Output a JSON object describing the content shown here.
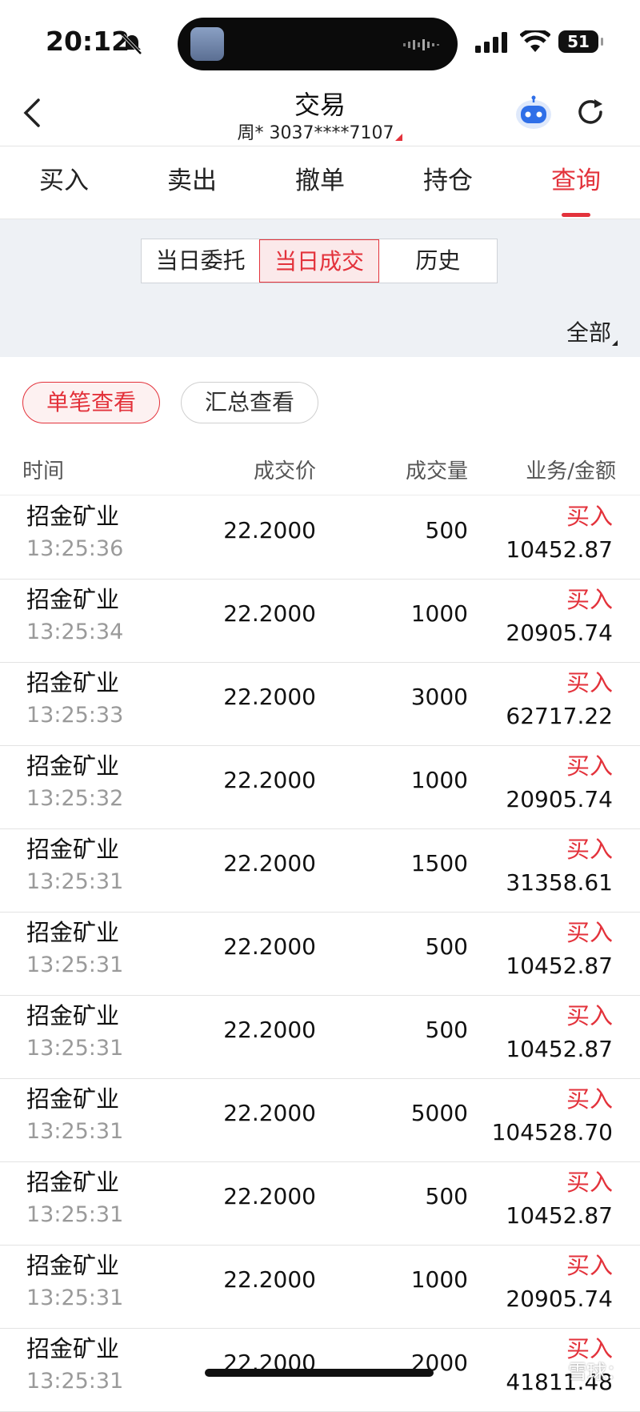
{
  "status_bar": {
    "time": "20:12",
    "battery": "51"
  },
  "header": {
    "title": "交易",
    "account": "周* 3037****7107"
  },
  "tabs": [
    {
      "label": "买入"
    },
    {
      "label": "卖出"
    },
    {
      "label": "撤单"
    },
    {
      "label": "持仓"
    },
    {
      "label": "查询",
      "active": true
    }
  ],
  "segments": [
    {
      "label": "当日委托"
    },
    {
      "label": "当日成交",
      "active": true
    },
    {
      "label": "历史"
    }
  ],
  "filter_label": "全部",
  "view_pills": [
    {
      "label": "单笔查看",
      "active": true
    },
    {
      "label": "汇总查看"
    }
  ],
  "columns": {
    "time": "时间",
    "price": "成交价",
    "qty": "成交量",
    "biz": "业务/金额"
  },
  "rows": [
    {
      "name": "招金矿业",
      "time": "13:25:36",
      "price": "22.2000",
      "qty": "500",
      "biz": "买入",
      "amount": "10452.87"
    },
    {
      "name": "招金矿业",
      "time": "13:25:34",
      "price": "22.2000",
      "qty": "1000",
      "biz": "买入",
      "amount": "20905.74"
    },
    {
      "name": "招金矿业",
      "time": "13:25:33",
      "price": "22.2000",
      "qty": "3000",
      "biz": "买入",
      "amount": "62717.22"
    },
    {
      "name": "招金矿业",
      "time": "13:25:32",
      "price": "22.2000",
      "qty": "1000",
      "biz": "买入",
      "amount": "20905.74"
    },
    {
      "name": "招金矿业",
      "time": "13:25:31",
      "price": "22.2000",
      "qty": "1500",
      "biz": "买入",
      "amount": "31358.61"
    },
    {
      "name": "招金矿业",
      "time": "13:25:31",
      "price": "22.2000",
      "qty": "500",
      "biz": "买入",
      "amount": "10452.87"
    },
    {
      "name": "招金矿业",
      "time": "13:25:31",
      "price": "22.2000",
      "qty": "500",
      "biz": "买入",
      "amount": "10452.87"
    },
    {
      "name": "招金矿业",
      "time": "13:25:31",
      "price": "22.2000",
      "qty": "5000",
      "biz": "买入",
      "amount": "104528.70"
    },
    {
      "name": "招金矿业",
      "time": "13:25:31",
      "price": "22.2000",
      "qty": "500",
      "biz": "买入",
      "amount": "10452.87"
    },
    {
      "name": "招金矿业",
      "time": "13:25:31",
      "price": "22.2000",
      "qty": "1000",
      "biz": "买入",
      "amount": "20905.74"
    },
    {
      "name": "招金矿业",
      "time": "13:25:31",
      "price": "22.2000",
      "qty": "2000",
      "biz": "买入",
      "amount": "41811.48"
    }
  ],
  "watermark": "雪球：",
  "colors": {
    "accent": "#e3323b",
    "panel_bg": "#eef1f5"
  }
}
